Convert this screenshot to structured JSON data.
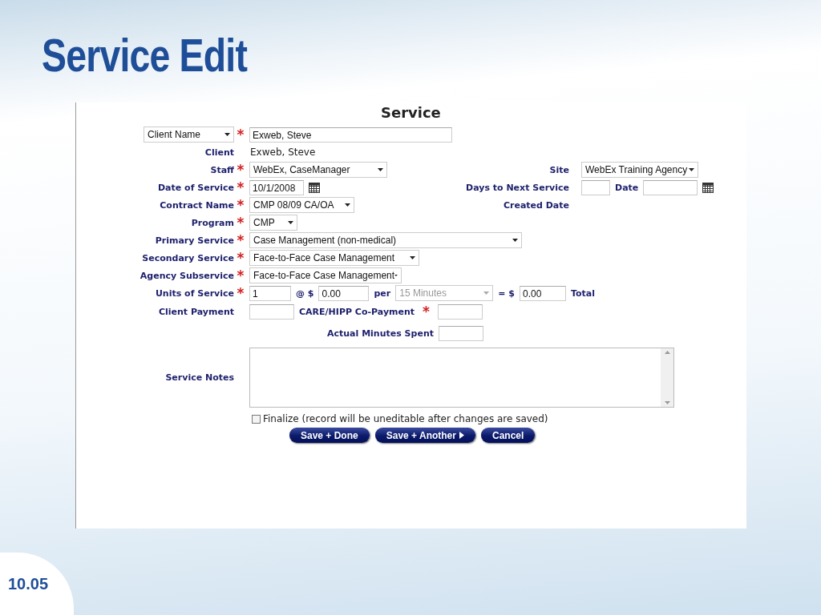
{
  "slide": {
    "title": "Service Edit",
    "page_number": "10.05"
  },
  "form": {
    "title": "Service",
    "rows": [
      {
        "label": {
          "kind": "select",
          "text": "Client Name"
        },
        "asterisk": "*",
        "controls": [
          {
            "kind": "text",
            "value": "Exweb, Steve"
          }
        ]
      },
      {
        "label": {
          "kind": "text",
          "text": "Client"
        },
        "controls": [
          {
            "kind": "static",
            "value": "Exweb, Steve"
          }
        ]
      },
      {
        "label": {
          "kind": "text",
          "text": "Staff"
        },
        "asterisk": "*",
        "controls": [
          {
            "kind": "select",
            "value": "WebEx, CaseManager"
          }
        ],
        "right": {
          "label": "Site",
          "controls": [
            {
              "kind": "select",
              "value": "WebEx Training Agency"
            }
          ]
        }
      },
      {
        "label": {
          "kind": "text",
          "text": "Date of Service"
        },
        "asterisk": "*",
        "controls": [
          {
            "kind": "date",
            "value": "10/1/2008"
          }
        ],
        "right": {
          "label": "Days to Next Service",
          "controls": [
            {
              "kind": "text"
            },
            {
              "kind": "label",
              "value": "Date"
            },
            {
              "kind": "date"
            }
          ]
        }
      },
      {
        "label": {
          "kind": "text",
          "text": "Contract Name"
        },
        "asterisk": "*",
        "controls": [
          {
            "kind": "select",
            "value": "CMP 08/09 CA/OA"
          }
        ],
        "right": {
          "label": "Created Date"
        }
      },
      {
        "label": {
          "kind": "text",
          "text": "Program"
        },
        "asterisk": "*",
        "controls": [
          {
            "kind": "select",
            "value": "CMP"
          }
        ]
      },
      {
        "label": {
          "kind": "text",
          "text": "Primary Service"
        },
        "asterisk": "*",
        "controls": [
          {
            "kind": "select",
            "value": "Case Management (non-medical)"
          }
        ]
      },
      {
        "label": {
          "kind": "text",
          "text": "Secondary Service"
        },
        "asterisk": "*",
        "controls": [
          {
            "kind": "select",
            "value": "Face-to-Face Case Management"
          }
        ]
      },
      {
        "label": {
          "kind": "text",
          "text": "Agency Subservice"
        },
        "asterisk": "*",
        "controls": [
          {
            "kind": "select",
            "value": "Face-to-Face Case Management"
          }
        ]
      },
      {
        "label": {
          "kind": "text",
          "text": "Units of Service"
        },
        "asterisk": "*",
        "controls": [
          {
            "kind": "text",
            "value": "1"
          },
          {
            "kind": "label",
            "value": "@ $"
          },
          {
            "kind": "text",
            "value": "0.00"
          },
          {
            "kind": "label",
            "value": "per"
          },
          {
            "kind": "select",
            "value": "15 Minutes",
            "disabled": true
          },
          {
            "kind": "label",
            "value": "= $"
          },
          {
            "kind": "text",
            "value": "0.00"
          },
          {
            "kind": "label",
            "value": "Total"
          }
        ]
      },
      {
        "label": {
          "kind": "text",
          "text": "Client Payment"
        },
        "controls": [
          {
            "kind": "text"
          },
          {
            "kind": "label",
            "value": "CARE/HIPP Co-Payment"
          },
          {
            "kind": "star",
            "value": "*"
          },
          {
            "kind": "text"
          }
        ]
      },
      {
        "controls": [
          {
            "kind": "label",
            "value": "Actual Minutes Spent"
          },
          {
            "kind": "text"
          }
        ]
      },
      {
        "label": {
          "kind": "text",
          "text": "Service Notes"
        },
        "controls": [
          {
            "kind": "textarea"
          }
        ]
      }
    ],
    "finalize": {
      "label": "Finalize (record will be uneditable after changes are saved)",
      "checked": false
    },
    "buttons": [
      {
        "label": "Save + Done",
        "kind": "plain"
      },
      {
        "label": "Save + Another",
        "kind": "next"
      },
      {
        "label": "Cancel",
        "kind": "plain"
      }
    ]
  }
}
